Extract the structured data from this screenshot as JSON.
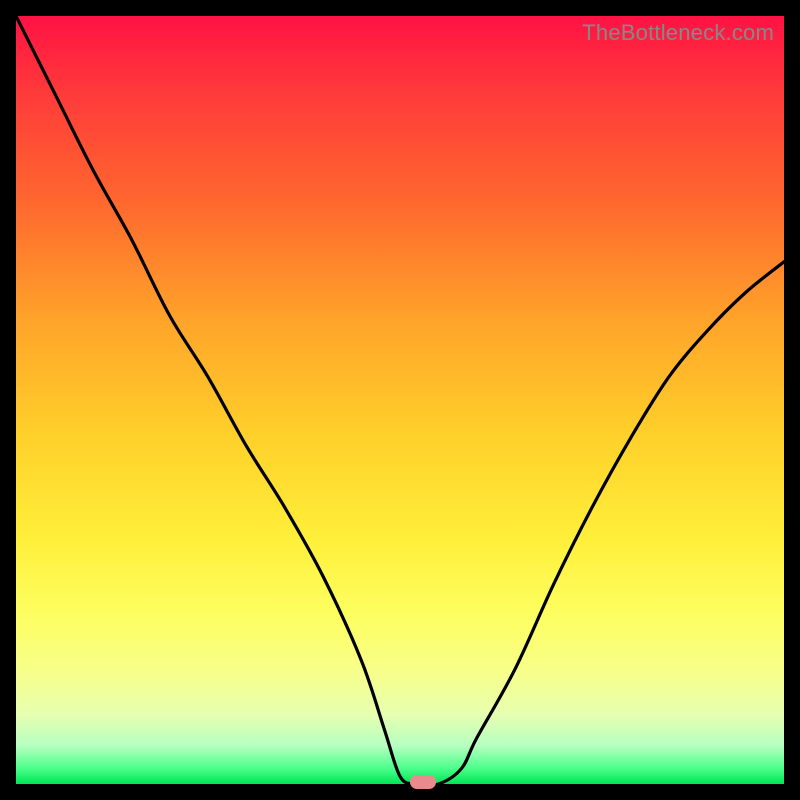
{
  "watermark": "TheBottleneck.com",
  "colors": {
    "frame": "#000000",
    "curve": "#000000",
    "marker": "#e98b8d"
  },
  "chart_data": {
    "type": "line",
    "title": "",
    "xlabel": "",
    "ylabel": "",
    "xlim": [
      0,
      100
    ],
    "ylim": [
      0,
      100
    ],
    "grid": false,
    "x": [
      0,
      5,
      10,
      15,
      20,
      25,
      30,
      35,
      40,
      45,
      48,
      50,
      52,
      55,
      58,
      60,
      65,
      70,
      75,
      80,
      85,
      90,
      95,
      100
    ],
    "values": [
      100,
      90,
      80,
      71,
      61,
      53,
      44,
      36,
      27,
      16,
      7,
      1,
      0,
      0,
      2,
      6,
      15,
      26,
      36,
      45,
      53,
      59,
      64,
      68
    ],
    "min_marker": {
      "x": 53,
      "y": 0
    },
    "annotations": [],
    "note": "Values estimated from pixel positions; y=0 is bottom (green), y=100 is top (red)."
  }
}
